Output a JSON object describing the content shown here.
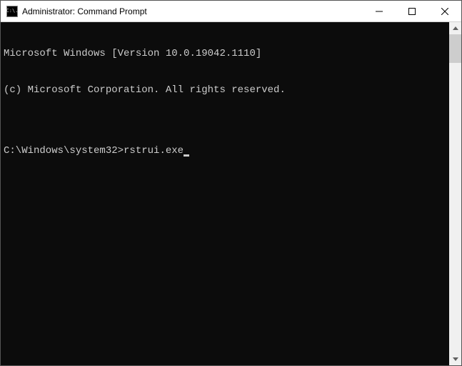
{
  "window": {
    "title": "Administrator: Command Prompt",
    "icon_text": "C:\\."
  },
  "terminal": {
    "line1": "Microsoft Windows [Version 10.0.19042.1110]",
    "line2": "(c) Microsoft Corporation. All rights reserved.",
    "blank": "",
    "prompt": "C:\\Windows\\system32>",
    "command": "rstrui.exe"
  }
}
